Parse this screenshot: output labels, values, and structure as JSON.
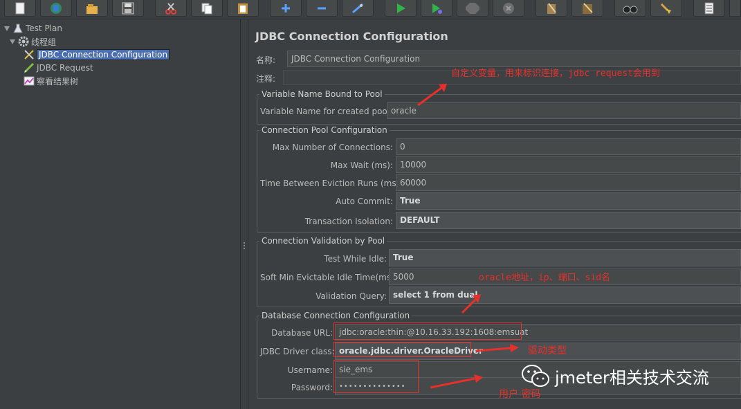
{
  "toolbar": {
    "buttons": [
      {
        "name": "new-icon"
      },
      {
        "name": "templates-icon"
      },
      {
        "name": "open-icon"
      },
      {
        "name": "save-icon"
      },
      {
        "name": "cut-icon"
      },
      {
        "name": "copy-icon"
      },
      {
        "name": "paste-icon"
      },
      {
        "name": "expand-icon"
      },
      {
        "name": "collapse-icon"
      },
      {
        "name": "toggle-icon"
      },
      {
        "name": "start-icon"
      },
      {
        "name": "start-no-pause-icon"
      },
      {
        "name": "stop-icon"
      },
      {
        "name": "shutdown-icon"
      },
      {
        "name": "clear-icon"
      },
      {
        "name": "clear-all-icon"
      },
      {
        "name": "search-icon"
      },
      {
        "name": "reset-search-icon"
      },
      {
        "name": "function-helper-icon"
      }
    ]
  },
  "tree": {
    "items": [
      {
        "label": "Test Plan",
        "icon": "flask-icon"
      },
      {
        "label": "线程组",
        "icon": "gear-icon"
      },
      {
        "label": "JDBC Connection Configuration",
        "icon": "tools-icon",
        "selected": true
      },
      {
        "label": "JDBC Request",
        "icon": "pencil-icon"
      },
      {
        "label": "察看结果树",
        "icon": "chart-icon"
      }
    ]
  },
  "panel": {
    "title": "JDBC Connection Configuration",
    "name_label": "名称:",
    "name_value": "JDBC Connection Configuration",
    "comment_label": "注释:",
    "comment_value": "",
    "pool_group": {
      "title": "Variable Name Bound to Pool",
      "var_label": "Variable Name for created pool:",
      "var_value": "oracle"
    },
    "conn_pool_group": {
      "title": "Connection Pool Configuration",
      "max_conn_label": "Max Number of Connections:",
      "max_conn_value": "0",
      "max_wait_label": "Max Wait (ms):",
      "max_wait_value": "10000",
      "eviction_label": "Time Between Eviction Runs (ms):",
      "eviction_value": "60000",
      "auto_commit_label": "Auto Commit:",
      "auto_commit_value": "True",
      "isolation_label": "Transaction Isolation:",
      "isolation_value": "DEFAULT"
    },
    "validation_group": {
      "title": "Connection Validation by Pool",
      "idle_label": "Test While Idle:",
      "idle_value": "True",
      "soft_min_label": "Soft Min Evictable Idle Time(ms):",
      "soft_min_value": "5000",
      "query_label": "Validation Query:",
      "query_value": "select 1 from dual"
    },
    "db_group": {
      "title": "Database Connection Configuration",
      "url_label": "Database URL:",
      "url_value": "jdbc:oracle:thin:@10.16.33.192:1608:emsuat",
      "driver_label": "JDBC Driver class:",
      "driver_value": "oracle.jdbc.driver.OracleDriver",
      "user_label": "Username:",
      "user_value": "sie_ems",
      "pass_label": "Password:",
      "pass_value": "••••••••••••••"
    }
  },
  "annotations": {
    "var_note": "自定义变量，用来标识连接，jdbc request会用到",
    "url_note": "oracle地址，ip、端口、sid名",
    "driver_note": "驱动类型",
    "user_note": "用户 密码",
    "color": "#e8302b"
  },
  "watermark": {
    "text": "jmeter相关技术交流",
    "icon": "wechat-icon"
  },
  "colors": {
    "background": "#3c3f41",
    "selection": "#4b6eaf",
    "annotation": "#e8302b"
  }
}
